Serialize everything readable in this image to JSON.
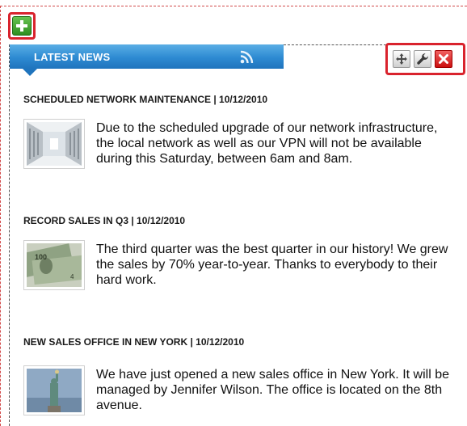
{
  "widget": {
    "title": "LATEST NEWS"
  },
  "toolbar": {
    "move_icon": "move-icon",
    "settings_icon": "wrench-icon",
    "close_icon": "close-icon"
  },
  "add_button": {
    "icon": "plus-icon"
  },
  "news": [
    {
      "heading": "SCHEDULED NETWORK MAINTENANCE | 10/12/2010",
      "body": "Due to the scheduled upgrade of our network infrastructure, the local network as well as our VPN will not be available during this Saturday, between 6am and 8am.",
      "thumbnail": "server-room-image"
    },
    {
      "heading": "RECORD SALES IN Q3 | 10/12/2010",
      "body": "The third quarter was the best quarter in our history! We grew the sales by 70% year-to-year. Thanks to everybody to their hard work.",
      "thumbnail": "dollar-bills-image"
    },
    {
      "heading": "NEW SALES OFFICE IN NEW YORK | 10/12/2010",
      "body": "We have just opened a new sales office in New York. It will be managed by Jennifer Wilson. The office is located on the 8th avenue.",
      "thumbnail": "statue-of-liberty-image"
    }
  ],
  "colors": {
    "header_blue": "#2d8ad2",
    "highlight_red": "#d9232d",
    "add_green": "#3fa52e"
  }
}
